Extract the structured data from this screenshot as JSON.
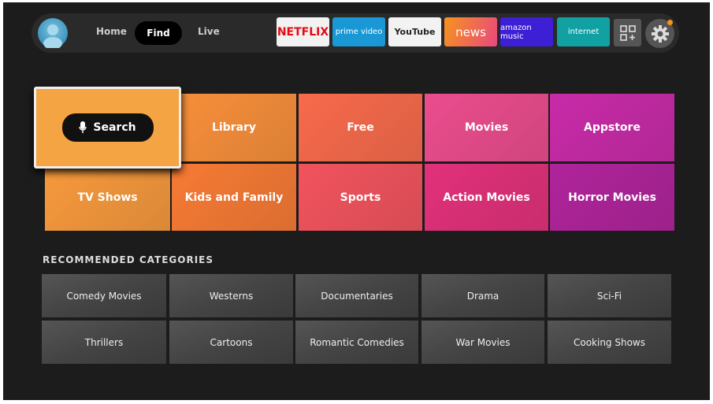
{
  "nav": {
    "items": [
      "Home",
      "Find",
      "Live"
    ],
    "active": "Find"
  },
  "apps": [
    {
      "label": "NETFLIX",
      "bg": "#f2f2f2",
      "color": "#e50914"
    },
    {
      "label": "prime video",
      "bg": "#1a98d5",
      "color": "#ffffff"
    },
    {
      "label": "YouTube",
      "bg": "#f2f2f2",
      "color": "#222222"
    },
    {
      "label": "news",
      "bg": "linear-gradient(110deg,#f7931e,#e9487e)",
      "color": "#ffffff"
    },
    {
      "label": "amazon music",
      "bg": "#3d1fd6",
      "color": "#ffffff"
    },
    {
      "label": "internet",
      "bg": "#12a1a3",
      "color": "#ffffff"
    }
  ],
  "icons": {
    "apps": "apps-grid-plus-icon",
    "settings": "gear-icon",
    "profile": "avatar-icon",
    "search": "microphone-icon"
  },
  "tiles": [
    {
      "label": "Search",
      "bg": "#f5a443"
    },
    {
      "label": "Library",
      "bg": "#f88f3a"
    },
    {
      "label": "Free",
      "bg": "#f86a4b"
    },
    {
      "label": "Movies",
      "bg": "#eb4c8d"
    },
    {
      "label": "Appstore",
      "bg": "#c82aa8"
    },
    {
      "label": "TV Shows",
      "bg": "#f7993c"
    },
    {
      "label": "Kids and Family",
      "bg": "#f77a34"
    },
    {
      "label": "Sports",
      "bg": "#f2535d"
    },
    {
      "label": "Action Movies",
      "bg": "#e2307a"
    },
    {
      "label": "Horror Movies",
      "bg": "#b0239b"
    }
  ],
  "recommended": {
    "title": "RECOMMENDED CATEGORIES",
    "items": [
      "Comedy Movies",
      "Westerns",
      "Documentaries",
      "Drama",
      "Sci-Fi",
      "Thrillers",
      "Cartoons",
      "Romantic Comedies",
      "War Movies",
      "Cooking Shows"
    ]
  }
}
